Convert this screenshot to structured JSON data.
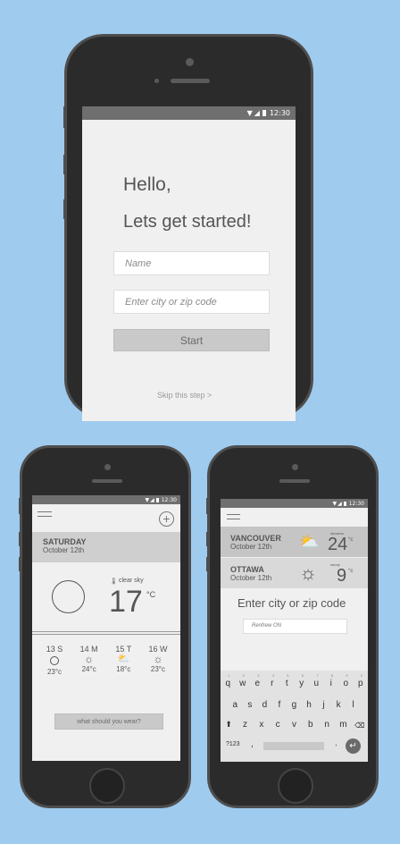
{
  "status_bar": {
    "time": "12:30"
  },
  "onboarding": {
    "greeting": "Hello,",
    "subtitle": "Lets get started!",
    "name_placeholder": "Name",
    "city_placeholder": "Enter city or zip code",
    "start_label": "Start",
    "skip_label": "Skip this step >"
  },
  "weather": {
    "day": "SATURDAY",
    "date": "October 12th",
    "condition": "clear sky",
    "temp": "17",
    "temp_unit": "°C",
    "forecast": [
      {
        "label": "13 S",
        "icon": "moon-icon",
        "temp": "23°c"
      },
      {
        "label": "14 M",
        "icon": "sun-icon",
        "temp": "24°c"
      },
      {
        "label": "15 T",
        "icon": "partly-cloudy-icon",
        "temp": "18°c"
      },
      {
        "label": "16 W",
        "icon": "sun-icon",
        "temp": "23°c"
      }
    ],
    "wear_button": "what should you wear?"
  },
  "cities": {
    "list": [
      {
        "name": "VANCOUVER",
        "date": "October 12th",
        "cond": "showers",
        "temp": "24",
        "unit": "°c",
        "icon": "rain-cloud-icon"
      },
      {
        "name": "OTTAWA",
        "date": "October 12th",
        "cond": "sunny",
        "temp": "9",
        "unit": "°c",
        "icon": "sun-icon"
      }
    ],
    "prompt": "Enter city or zip code",
    "input_value": "Renfrew ON"
  },
  "keyboard": {
    "row1": [
      "q",
      "w",
      "e",
      "r",
      "t",
      "y",
      "u",
      "i",
      "o",
      "p"
    ],
    "row1_nums": [
      "1",
      "2",
      "3",
      "4",
      "5",
      "6",
      "7",
      "8",
      "9",
      "0"
    ],
    "row2": [
      "a",
      "s",
      "d",
      "f",
      "g",
      "h",
      "j",
      "k",
      "l"
    ],
    "row3": [
      "z",
      "x",
      "c",
      "v",
      "b",
      "n",
      "m"
    ],
    "sym": "?123",
    "comma": ",",
    "period": "."
  }
}
